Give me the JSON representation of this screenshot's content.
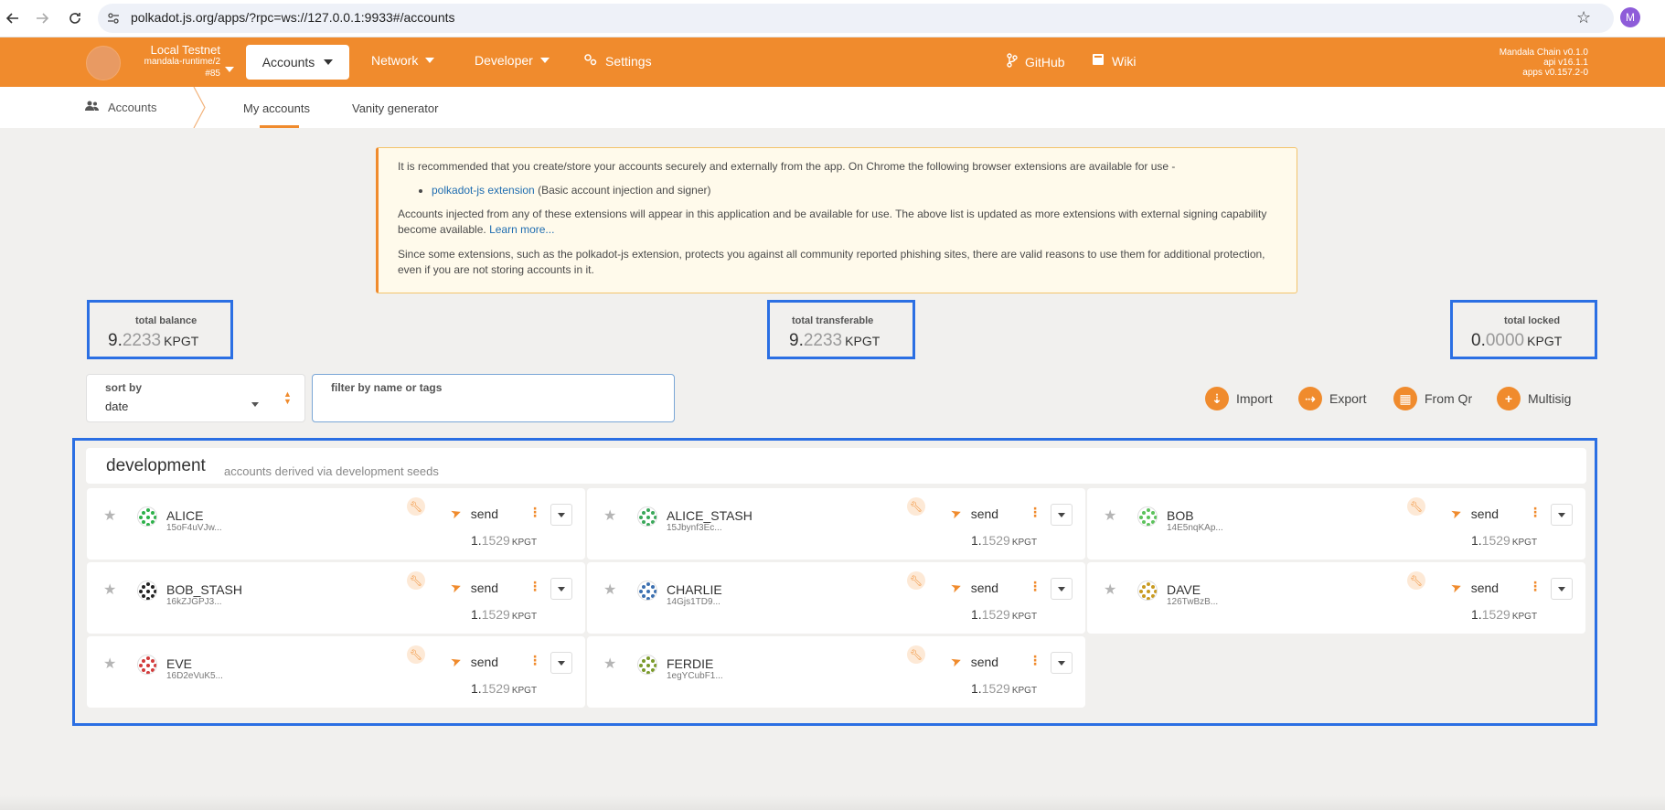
{
  "browser": {
    "url": "polkadot.js.org/apps/?rpc=ws://127.0.0.1:9933#/accounts",
    "profile_initial": "M"
  },
  "topmenu": {
    "chain_name": "Local Testnet",
    "runtime": "mandala-runtime/2",
    "block": "#85",
    "items": [
      {
        "label": "Accounts",
        "active": true
      },
      {
        "label": "Network"
      },
      {
        "label": "Developer"
      },
      {
        "label": "Settings"
      }
    ],
    "links": [
      {
        "label": "GitHub"
      },
      {
        "label": "Wiki"
      }
    ],
    "versions": [
      "Mandala Chain v0.1.0",
      "api v16.1.1",
      "apps v0.157.2-0"
    ]
  },
  "subnav": {
    "section": "Accounts",
    "tabs": [
      {
        "label": "My accounts",
        "active": true
      },
      {
        "label": "Vanity generator"
      }
    ]
  },
  "info": {
    "p1": "It is recommended that you create/store your accounts securely and externally from the app. On Chrome the following browser extensions are available for use -",
    "ext_link": "polkadot-js extension",
    "ext_desc": " (Basic account injection and signer)",
    "p2": "Accounts injected from any of these extensions will appear in this application and be available for use. The above list is updated as more extensions with external signing capability become available. ",
    "learn_more": "Learn more...",
    "p3": "Since some extensions, such as the polkadot-js extension, protects you against all community reported phishing sites, there are valid reasons to use them for additional protection, even if you are not storing accounts in it."
  },
  "summary": {
    "balance": {
      "label": "total balance",
      "int": "9.",
      "frac": "2233",
      "unit": "KPGT"
    },
    "transferable": {
      "label": "total transferable",
      "int": "9.",
      "frac": "2233",
      "unit": "KPGT"
    },
    "locked": {
      "label": "total locked",
      "int": "0.",
      "frac": "0000",
      "unit": "KPGT"
    }
  },
  "controls": {
    "sort_label": "sort by",
    "sort_value": "date",
    "filter_label": "filter by name or tags",
    "actions": [
      {
        "label": "Import",
        "icon": "import-icon"
      },
      {
        "label": "Export",
        "icon": "export-icon"
      },
      {
        "label": "From Qr",
        "icon": "qr-icon"
      },
      {
        "label": "Multisig",
        "icon": "plus-icon"
      }
    ]
  },
  "group": {
    "title": "development",
    "subtitle": "accounts derived via development seeds",
    "send_label": "send",
    "accounts": [
      {
        "name": "ALICE",
        "address": "15oF4uVJw...",
        "bal_int": "1.",
        "bal_frac": "1529",
        "unit": "KPGT",
        "color": "#2db14a"
      },
      {
        "name": "ALICE_STASH",
        "address": "15Jbynf3Ec...",
        "bal_int": "1.",
        "bal_frac": "1529",
        "unit": "KPGT",
        "color": "#3aa85a"
      },
      {
        "name": "BOB",
        "address": "14E5nqKAp...",
        "bal_int": "1.",
        "bal_frac": "1529",
        "unit": "KPGT",
        "color": "#5cc25c"
      },
      {
        "name": "BOB_STASH",
        "address": "16kZJGPJ3...",
        "bal_int": "1.",
        "bal_frac": "1529",
        "unit": "KPGT",
        "color": "#222222"
      },
      {
        "name": "CHARLIE",
        "address": "14Gjs1TD9...",
        "bal_int": "1.",
        "bal_frac": "1529",
        "unit": "KPGT",
        "color": "#3b6fb0"
      },
      {
        "name": "DAVE",
        "address": "126TwBzB...",
        "bal_int": "1.",
        "bal_frac": "1529",
        "unit": "KPGT",
        "color": "#c89a20"
      },
      {
        "name": "EVE",
        "address": "16D2eVuK5...",
        "bal_int": "1.",
        "bal_frac": "1529",
        "unit": "KPGT",
        "color": "#d23b3b"
      },
      {
        "name": "FERDIE",
        "address": "1egYCubF1...",
        "bal_int": "1.",
        "bal_frac": "1529",
        "unit": "KPGT",
        "color": "#7a9a2a"
      }
    ]
  }
}
